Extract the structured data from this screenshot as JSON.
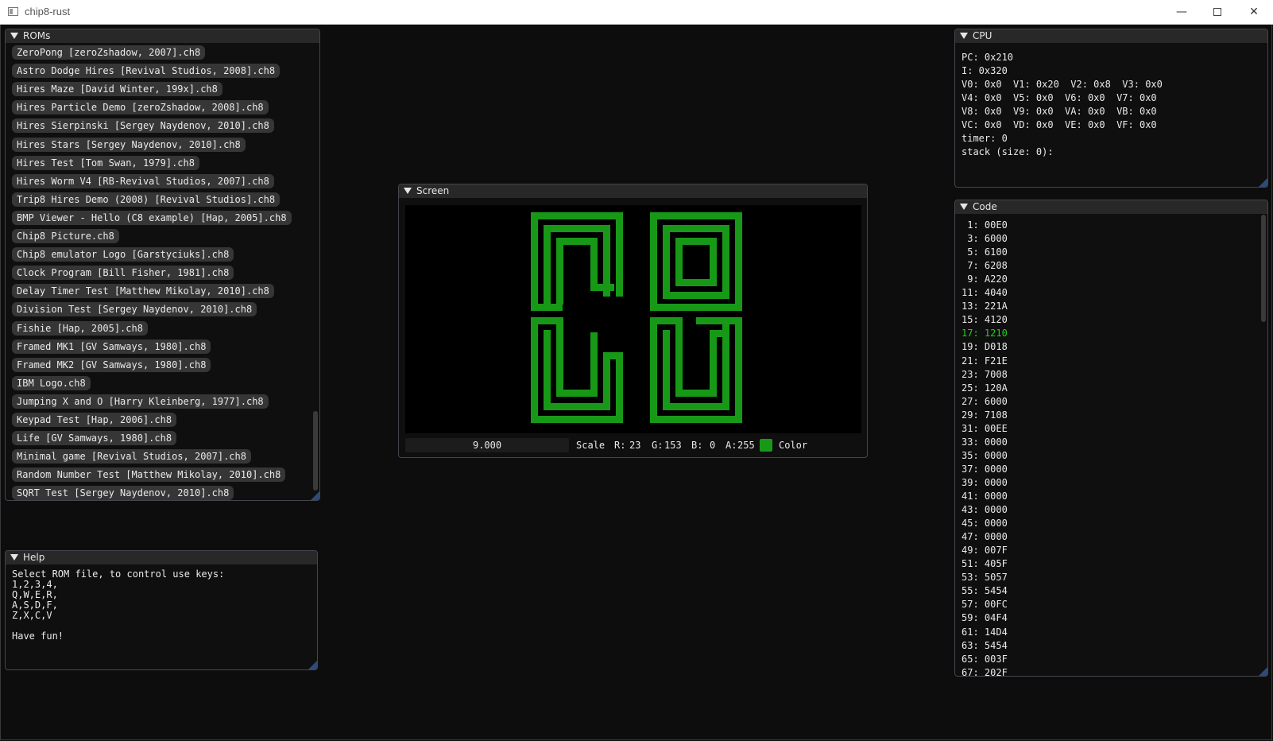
{
  "window": {
    "title": "chip8-rust",
    "min_glyph": "—",
    "close_glyph": "✕"
  },
  "roms": {
    "title": "ROMs",
    "items": [
      "ZeroPong [zeroZshadow, 2007].ch8",
      "Astro Dodge Hires [Revival Studios, 2008].ch8",
      "Hires Maze [David Winter, 199x].ch8",
      "Hires Particle Demo [zeroZshadow, 2008].ch8",
      "Hires Sierpinski [Sergey Naydenov, 2010].ch8",
      "Hires Stars [Sergey Naydenov, 2010].ch8",
      "Hires Test [Tom Swan, 1979].ch8",
      "Hires Worm V4 [RB-Revival Studios, 2007].ch8",
      "Trip8 Hires Demo (2008) [Revival Studios].ch8",
      "BMP Viewer - Hello (C8 example) [Hap, 2005].ch8",
      "Chip8 Picture.ch8",
      "Chip8 emulator Logo [Garstyciuks].ch8",
      "Clock Program [Bill Fisher, 1981].ch8",
      "Delay Timer Test [Matthew Mikolay, 2010].ch8",
      "Division Test [Sergey Naydenov, 2010].ch8",
      "Fishie [Hap, 2005].ch8",
      "Framed MK1 [GV Samways, 1980].ch8",
      "Framed MK2 [GV Samways, 1980].ch8",
      "IBM Logo.ch8",
      "Jumping X and O [Harry Kleinberg, 1977].ch8",
      "Keypad Test [Hap, 2006].ch8",
      "Life [GV Samways, 1980].ch8",
      "Minimal game [Revival Studios, 2007].ch8",
      "Random Number Test [Matthew Mikolay, 2010].ch8",
      "SQRT Test [Sergey Naydenov, 2010].ch8"
    ]
  },
  "help": {
    "title": "Help",
    "text": "Select ROM file, to control use keys:\n1,2,3,4,\nQ,W,E,R,\nA,S,D,F,\nZ,X,C,V\n\nHave fun!"
  },
  "screen": {
    "title": "Screen",
    "scale_value": "9.000",
    "scale_label": "Scale",
    "r_label": "R:",
    "r_value": "23",
    "g_label": "G:",
    "g_value": "153",
    "b_label": "B:",
    "b_value": "0",
    "a_label": "A:",
    "a_value": "255",
    "color_label": "Color",
    "pixel_color": "#179917"
  },
  "cpu": {
    "title": "CPU",
    "lines": [
      "PC: 0x210",
      "I: 0x320",
      "V0: 0x0  V1: 0x20  V2: 0x8  V3: 0x0",
      "V4: 0x0  V5: 0x0  V6: 0x0  V7: 0x0",
      "V8: 0x0  V9: 0x0  VA: 0x0  VB: 0x0",
      "VC: 0x0  VD: 0x0  VE: 0x0  VF: 0x0",
      "timer: 0",
      "stack (size: 0):"
    ]
  },
  "code": {
    "title": "Code",
    "current_index": 8,
    "lines": [
      " 1: 00E0",
      " 3: 6000",
      " 5: 6100",
      " 7: 6208",
      " 9: A220",
      "11: 4040",
      "13: 221A",
      "15: 4120",
      "17: 1210",
      "19: D018",
      "21: F21E",
      "23: 7008",
      "25: 120A",
      "27: 6000",
      "29: 7108",
      "31: 00EE",
      "33: 0000",
      "35: 0000",
      "37: 0000",
      "39: 0000",
      "41: 0000",
      "43: 0000",
      "45: 0000",
      "47: 0000",
      "49: 007F",
      "51: 405F",
      "53: 5057",
      "55: 5454",
      "57: 00FC",
      "59: 04F4",
      "61: 14D4",
      "63: 5454",
      "65: 003F",
      "67: 202F"
    ]
  }
}
